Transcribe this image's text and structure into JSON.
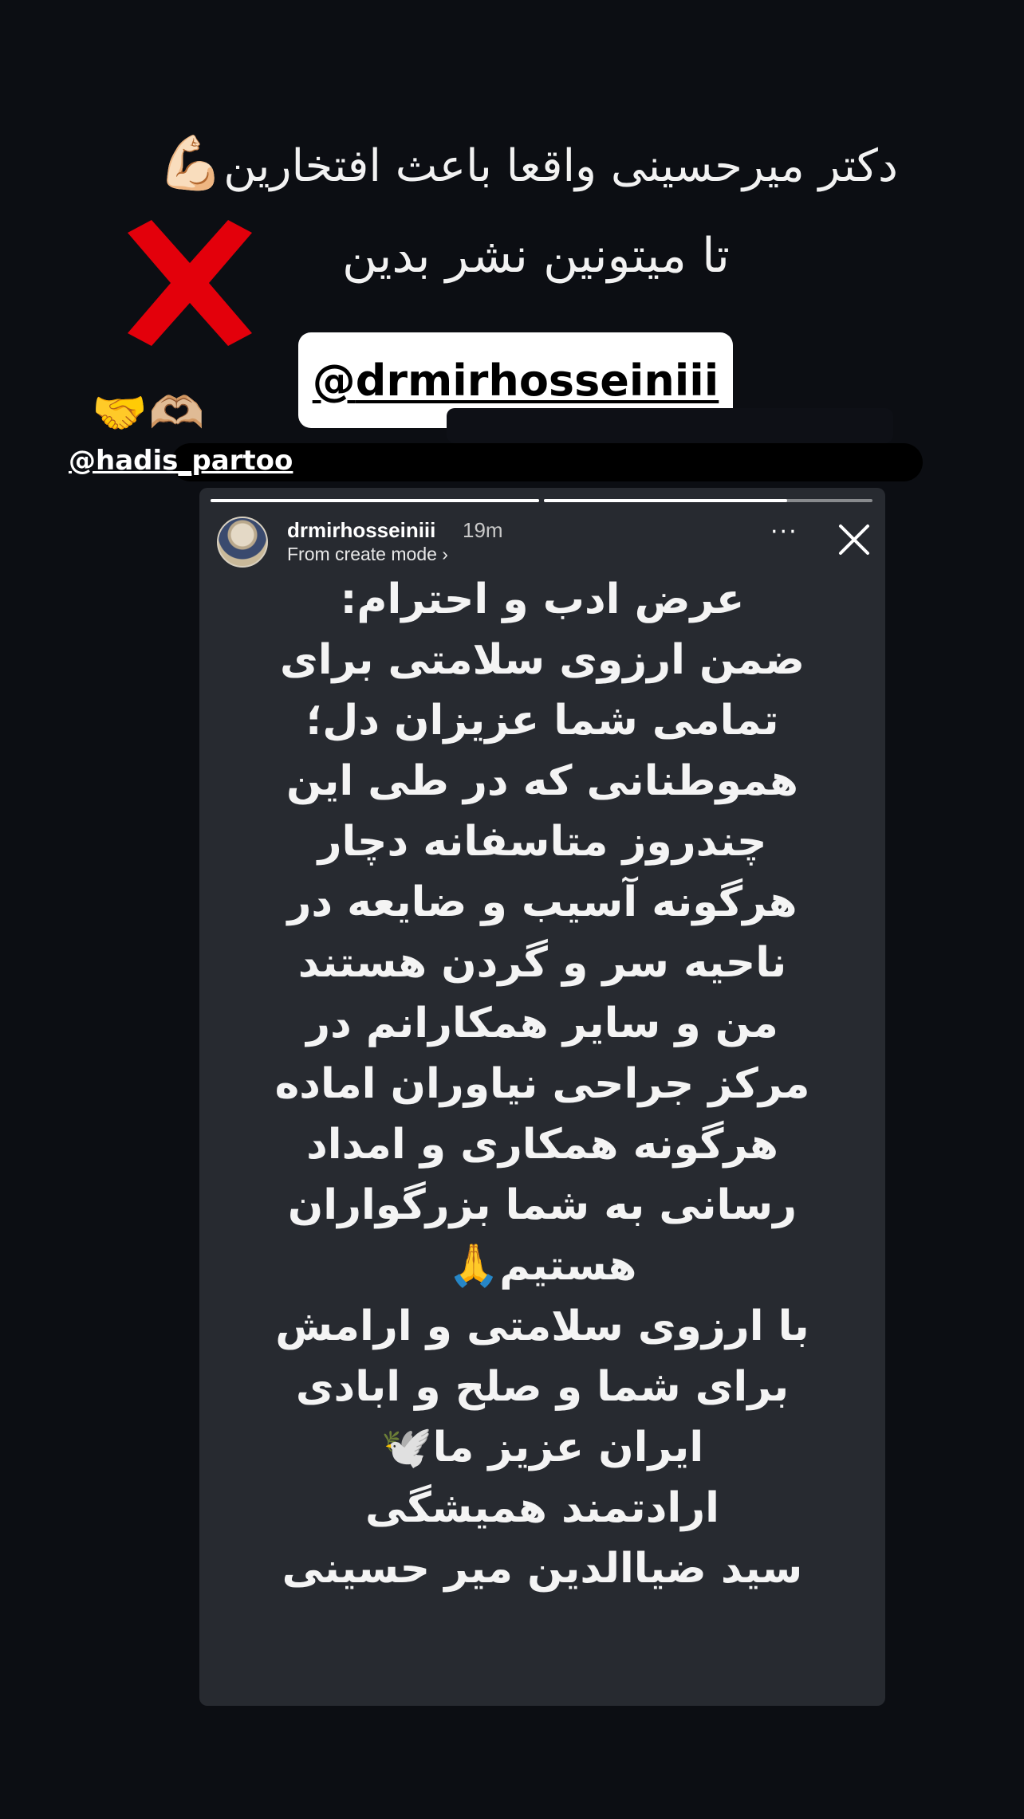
{
  "header": {
    "line1_text": "دکتر میرحسینی واقعا باعث افتخارین",
    "line1_emoji": "💪🏻",
    "line2_text": "تا میتونین نشر بدین",
    "red_x_emoji": "❌",
    "mention_icon": "@",
    "mention_handle": "drmirhosseiniii",
    "small_emojis": "🤝🫶🏼",
    "credit_handle": "@hadis_partoo"
  },
  "story": {
    "username": "drmirhosseiniii",
    "time": "19m",
    "subline": "From create mode ›",
    "more_label": "···",
    "progress": [
      1.0,
      0.74
    ],
    "lines": [
      "عرض ادب و احترام:",
      "ضمن ارزوی سلامتی برای",
      "تمامی  شما عزیزان دل؛",
      "هموطنانی که در طی این",
      "چندروز متاسفانه دچار",
      "هرگونه آسیب و ضایعه در",
      "ناحیه سر و گردن هستند",
      "من و سایر همکارانم در",
      "مرکز جراحی نیاوران اماده",
      "هرگونه همکاری و امداد",
      "رسانی به شما بزرگواران",
      "هستیم🙏",
      "با ارزوی سلامتی و ارامش",
      "برای شما و صلح و ابادی",
      "ایران عزیز ما🕊️",
      "ارادتمند همیشگی",
      "سید ضیاالدین میر حسینی"
    ]
  },
  "colors": {
    "background": "#0c0e13",
    "story_bg": "#272a30",
    "red_x": "#e3000b"
  }
}
